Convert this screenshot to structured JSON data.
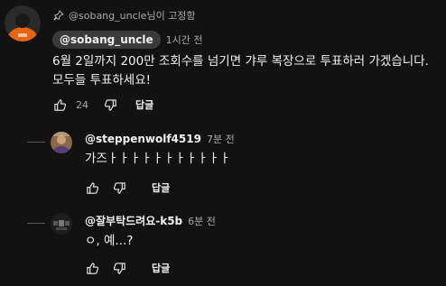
{
  "pinned": {
    "label": "@sobang_uncle님이 고정함"
  },
  "main_comment": {
    "author": "@sobang_uncle",
    "time": "1시간 전",
    "text_line1": "6월 2일까지 200만 조회수를 넘기면 갸루 복장으로 투표하러 가겠습니다.",
    "text_line2": "모두들 투표하세요!",
    "likes": "24",
    "reply_label": "답글"
  },
  "replies": [
    {
      "author": "@steppenwolf4519",
      "time": "7분 전",
      "text": "가즈ㅏㅏㅏㅏㅏㅏㅏㅏㅏㅏㅏ",
      "reply_label": "답글"
    },
    {
      "author": "@잘부탁드려요-k5b",
      "time": "6분 전",
      "text": "ㅇ, 예...?",
      "reply_label": "답글"
    }
  ],
  "colors": {
    "background": "#121212",
    "chip": "#3a3a3a",
    "muted": "#aaaaaa",
    "text": "#f1f1f1"
  },
  "icons": [
    "pin-icon",
    "thumbs-up-icon",
    "thumbs-down-icon"
  ]
}
